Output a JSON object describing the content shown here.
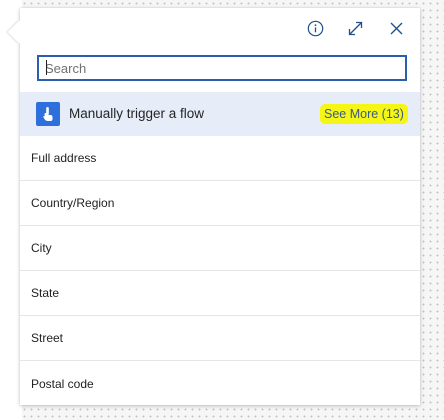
{
  "search": {
    "placeholder": "Search",
    "value": ""
  },
  "header": {
    "icons": [
      "info-icon",
      "expand-icon",
      "close-icon"
    ]
  },
  "trigger": {
    "label": "Manually trigger a flow",
    "see_more": "See More (13)",
    "icon": "touch-hand-icon",
    "icon_color": "#2f6fdb",
    "row_color": "#e6ecf8",
    "highlight_color": "#f5f516"
  },
  "items": [
    {
      "label": "Full address"
    },
    {
      "label": "Country/Region"
    },
    {
      "label": "City"
    },
    {
      "label": "State"
    },
    {
      "label": "Street"
    },
    {
      "label": "Postal code"
    }
  ]
}
